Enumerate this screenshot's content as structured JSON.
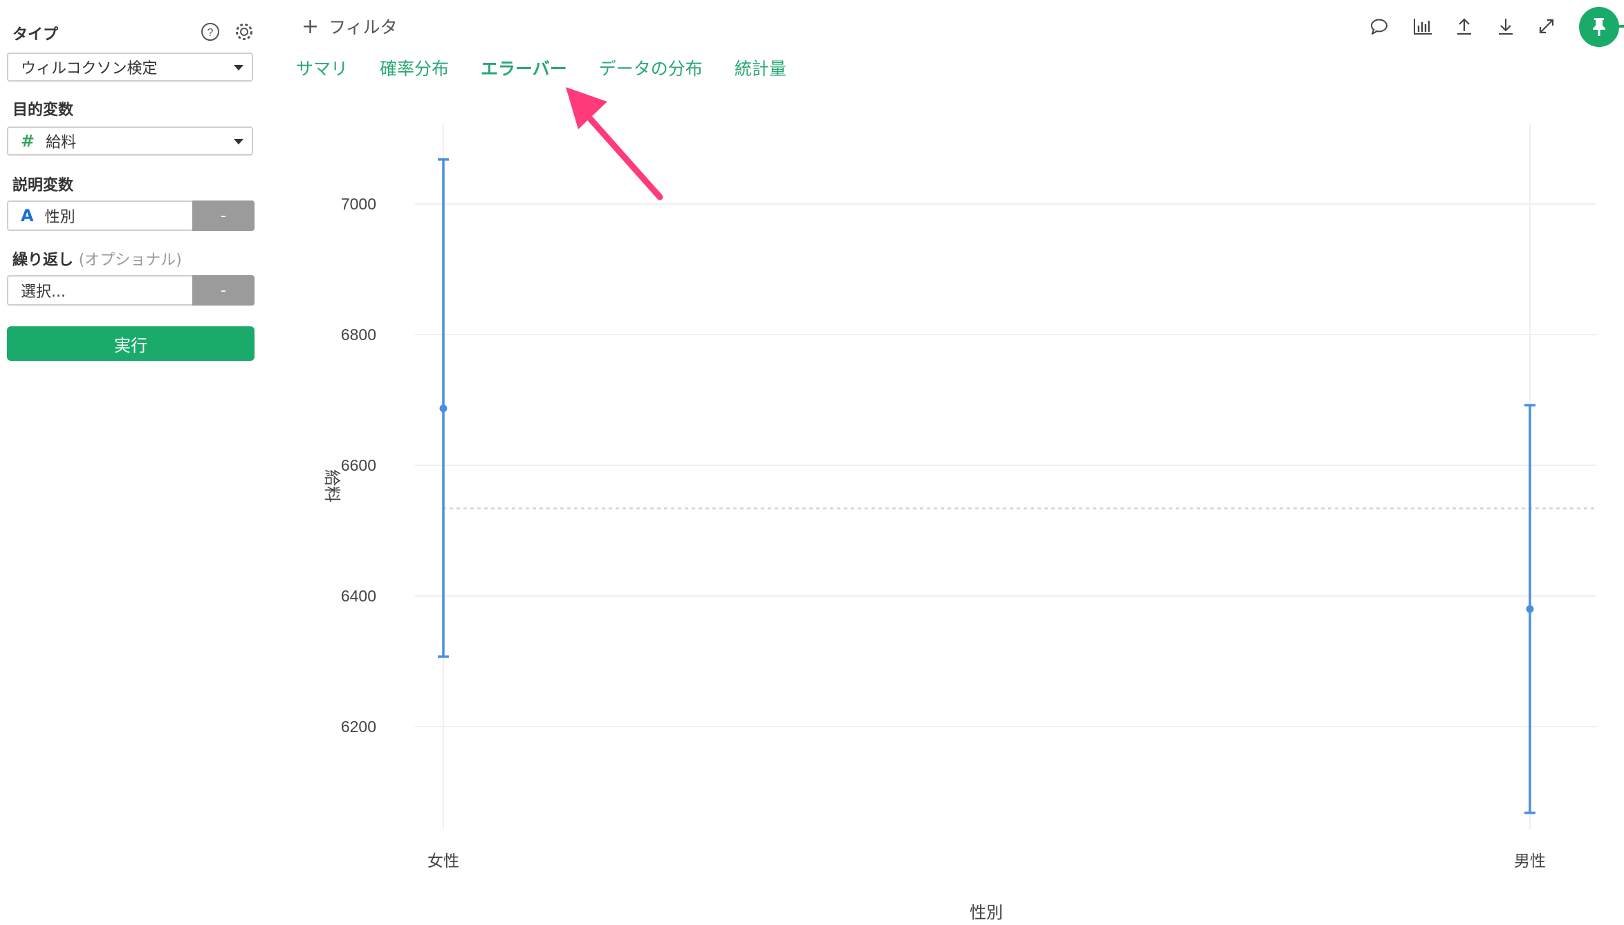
{
  "sidebar": {
    "type_label": "タイプ",
    "type_value": "ウィルコクソン検定",
    "target_label": "目的変数",
    "target_value": "給料",
    "target_glyph": "#",
    "explanatory_label": "説明変数",
    "explanatory_value": "性別",
    "explanatory_glyph": "A",
    "explanatory_remove": "-",
    "repeat_label": "繰り返し",
    "repeat_optional": "(オプショナル)",
    "repeat_placeholder": "選択...",
    "repeat_remove": "-",
    "run_label": "実行"
  },
  "header": {
    "filter_plus": "+",
    "filter_label": "フィルタ",
    "tabs": [
      {
        "label": "サマリ",
        "active": false
      },
      {
        "label": "確率分布",
        "active": false
      },
      {
        "label": "エラーバー",
        "active": true
      },
      {
        "label": "データの分布",
        "active": false
      },
      {
        "label": "統計量",
        "active": false
      }
    ]
  },
  "toolbar_icons": [
    "comment-icon",
    "chart-icon",
    "upload-icon",
    "download-icon",
    "expand-icon",
    "pin-icon"
  ],
  "colors": {
    "accent": "#1aab6a",
    "tab_text": "#2aa872",
    "series": "#4a8ee0",
    "annotation_arrow": "#ff3b7a"
  },
  "chart_data": {
    "type": "errorbar",
    "xlabel": "性別",
    "ylabel": "給料",
    "categories": [
      "女性",
      "男性"
    ],
    "series": [
      {
        "points": [
          {
            "category": "女性",
            "mean": 6687,
            "lower": 6307,
            "upper": 7068
          },
          {
            "category": "男性",
            "mean": 6380,
            "lower": 6068,
            "upper": 6692
          }
        ]
      }
    ],
    "reference_line": 6534,
    "yticks": [
      6200,
      6400,
      6600,
      6800,
      7000
    ],
    "ylim": [
      6020,
      7120
    ],
    "grid": true
  }
}
